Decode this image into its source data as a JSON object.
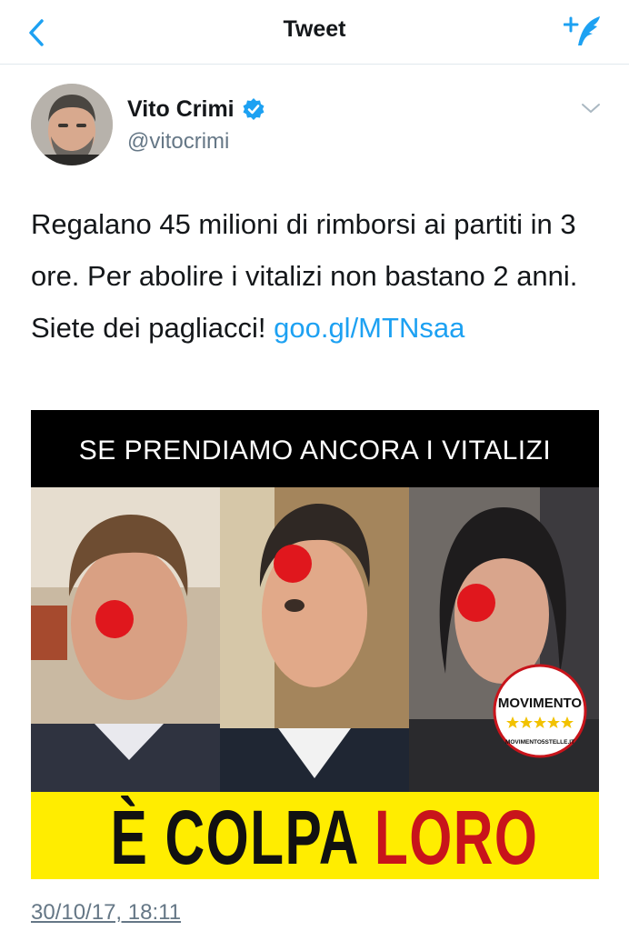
{
  "nav": {
    "title": "Tweet",
    "back_icon": "chevron-left-icon",
    "compose_icon": "compose-tweet-icon"
  },
  "author": {
    "name": "Vito Crimi",
    "handle": "@vitocrimi",
    "verified": true
  },
  "tweet": {
    "text": "Regalano 45 milioni di rimborsi ai partiti in 3 ore. Per abolire i vitalizi non bastano 2 anni. Siete dei pagliacci! ",
    "link": "goo.gl/MTNsaa",
    "timestamp": "30/10/17, 18:11"
  },
  "media": {
    "banner": "SE PRENDIAMO ANCORA I VITALIZI",
    "caption_black": "È COLPA",
    "caption_red": "LORO",
    "logo_text": "MOVIMENTO",
    "logo_url": "MOVIMENTO5STELLE.IT"
  },
  "colors": {
    "accent": "#1da1f2",
    "yellow": "#ffed00",
    "red": "#c8141b",
    "secondary_text": "#657786"
  }
}
